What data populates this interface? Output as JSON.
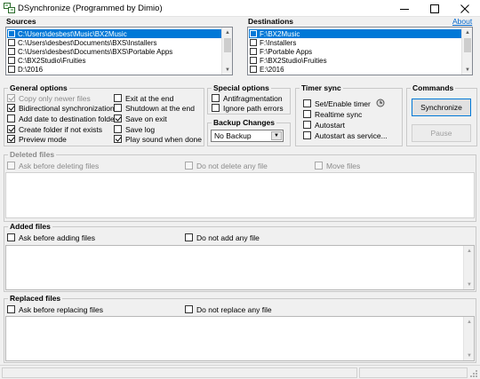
{
  "window": {
    "title": "DSynchronize (Programmed by Dimio)",
    "minimize_icon": "minimize-icon",
    "maximize_icon": "maximize-icon",
    "close_icon": "close-icon"
  },
  "sources": {
    "label": "Sources",
    "items": [
      {
        "path": "C:\\Users\\desbest\\Music\\BX2Music",
        "selected": true
      },
      {
        "path": "C:\\Users\\desbest\\Documents\\BXS\\Installers",
        "selected": false
      },
      {
        "path": "C:\\Users\\desbest\\Documents\\BXS\\Portable Apps",
        "selected": false
      },
      {
        "path": "C:\\BX2Studio\\Fruities",
        "selected": false
      },
      {
        "path": "D:\\2016",
        "selected": false
      }
    ]
  },
  "destinations": {
    "label": "Destinations",
    "about_link": "About",
    "items": [
      {
        "path": "F:\\BX2Music",
        "selected": true
      },
      {
        "path": "F:\\Installers",
        "selected": false
      },
      {
        "path": "F:\\Portable Apps",
        "selected": false
      },
      {
        "path": "F:\\BX2Studio\\Fruities",
        "selected": false
      },
      {
        "path": "E:\\2016",
        "selected": false
      }
    ]
  },
  "general_options": {
    "label": "General options",
    "col1": [
      {
        "label": "Copy only newer files",
        "checked": true,
        "disabled": true
      },
      {
        "label": "Bidirectional synchronization",
        "checked": true,
        "disabled": false
      },
      {
        "label": "Add date to destination folder",
        "checked": false,
        "disabled": false
      },
      {
        "label": "Create folder if not exists",
        "checked": true,
        "disabled": false
      },
      {
        "label": "Preview mode",
        "checked": true,
        "disabled": false
      }
    ],
    "col2": [
      {
        "label": "Exit at the end",
        "checked": false,
        "disabled": false
      },
      {
        "label": "Shutdown at the end",
        "checked": false,
        "disabled": false
      },
      {
        "label": "Save on exit",
        "checked": true,
        "disabled": false
      },
      {
        "label": "Save log",
        "checked": false,
        "disabled": false
      },
      {
        "label": "Play sound when done",
        "checked": true,
        "disabled": false
      }
    ]
  },
  "special_options": {
    "label": "Special options",
    "items": [
      {
        "label": "Antifragmentation",
        "checked": false
      },
      {
        "label": "Ignore path errors",
        "checked": false
      }
    ]
  },
  "backup_changes": {
    "label": "Backup Changes",
    "selected": "No Backup"
  },
  "timer_sync": {
    "label": "Timer sync",
    "items": [
      {
        "label": "Set/Enable timer",
        "checked": false
      },
      {
        "label": "Realtime sync",
        "checked": false
      },
      {
        "label": "Autostart",
        "checked": false
      },
      {
        "label": "Autostart as service...",
        "checked": false
      }
    ],
    "timer_icon": "clock-icon"
  },
  "commands": {
    "label": "Commands",
    "synchronize": "Synchronize",
    "pause": "Pause"
  },
  "deleted_files": {
    "label": "Deleted files",
    "options": [
      {
        "label": "Ask before deleting files",
        "checked": false
      },
      {
        "label": "Do not delete any file",
        "checked": false
      },
      {
        "label": "Move files",
        "checked": false
      }
    ]
  },
  "added_files": {
    "label": "Added files",
    "options": [
      {
        "label": "Ask before adding files",
        "checked": false
      },
      {
        "label": "Do not add any file",
        "checked": false
      }
    ]
  },
  "replaced_files": {
    "label": "Replaced files",
    "options": [
      {
        "label": "Ask before replacing files",
        "checked": false
      },
      {
        "label": "Do not replace any file",
        "checked": false
      }
    ]
  }
}
